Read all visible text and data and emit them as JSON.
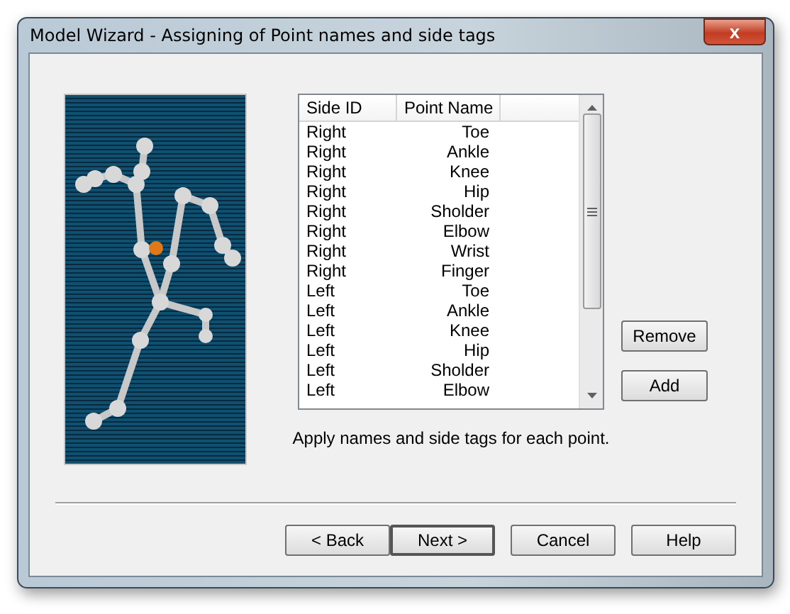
{
  "window": {
    "title": "Model Wizard - Assigning of Point names and side tags",
    "close": "x"
  },
  "table": {
    "columns": [
      "Side ID",
      "Point Name"
    ],
    "rows": [
      {
        "side": "Right",
        "point": "Toe"
      },
      {
        "side": "Right",
        "point": "Ankle"
      },
      {
        "side": "Right",
        "point": "Knee"
      },
      {
        "side": "Right",
        "point": "Hip"
      },
      {
        "side": "Right",
        "point": "Sholder"
      },
      {
        "side": "Right",
        "point": "Elbow"
      },
      {
        "side": "Right",
        "point": "Wrist"
      },
      {
        "side": "Right",
        "point": "Finger"
      },
      {
        "side": "Left",
        "point": "Toe"
      },
      {
        "side": "Left",
        "point": "Ankle"
      },
      {
        "side": "Left",
        "point": "Knee"
      },
      {
        "side": "Left",
        "point": "Hip"
      },
      {
        "side": "Left",
        "point": "Sholder"
      },
      {
        "side": "Left",
        "point": "Elbow"
      }
    ]
  },
  "caption": "Apply names and side tags for each point.",
  "side_buttons": [
    "Remove",
    "Add"
  ],
  "buttons": [
    {
      "label": "< Back",
      "default": false
    },
    {
      "label": "Next >",
      "default": true
    },
    {
      "label": "Cancel",
      "default": false
    },
    {
      "label": "Help",
      "default": false
    }
  ]
}
